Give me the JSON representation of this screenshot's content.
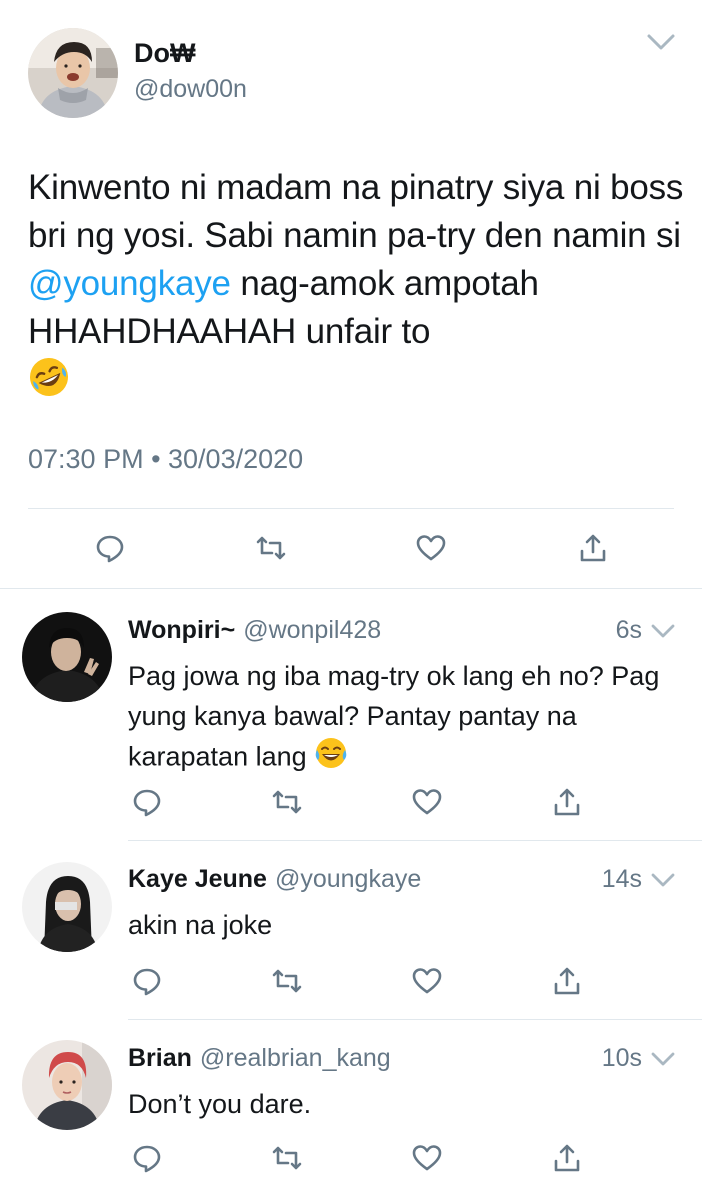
{
  "main_tweet": {
    "display_name": "Do₩",
    "handle": "@dow00n",
    "text_before_mention": "Kinwento ni madam na pinatry siya ni boss bri ng yosi. Sabi namin pa-try den namin si ",
    "mention": "@youngkaye",
    "text_after_mention": " nag-amok ampotah HHAHDHAAHAH unfair to",
    "emoji": "rolling-on-floor-laughing",
    "timestamp": "07:30 PM • 30/03/2020"
  },
  "replies": [
    {
      "display_name": "Wonpiri~",
      "handle": "@wonpil428",
      "time": "6s",
      "text": "Pag jowa ng iba mag-try ok lang eh no? Pag yung kanya bawal? Pantay pantay na karapatan lang",
      "emoji": "face-with-tears-of-joy"
    },
    {
      "display_name": "Kaye Jeune",
      "handle": "@youngkaye",
      "time": "14s",
      "text": "akin na joke",
      "emoji": ""
    },
    {
      "display_name": "Brian",
      "handle": "@realbrian_kang",
      "time": "10s",
      "text": "Don’t you dare.",
      "emoji": ""
    }
  ],
  "icons": {
    "reply": "reply-icon",
    "retweet": "retweet-icon",
    "like": "like-icon",
    "share": "share-icon",
    "more": "chevron-down-icon"
  },
  "colors": {
    "text": "#14171a",
    "secondary": "#657786",
    "link": "#1da1f2",
    "divider": "#e1e8ed"
  }
}
